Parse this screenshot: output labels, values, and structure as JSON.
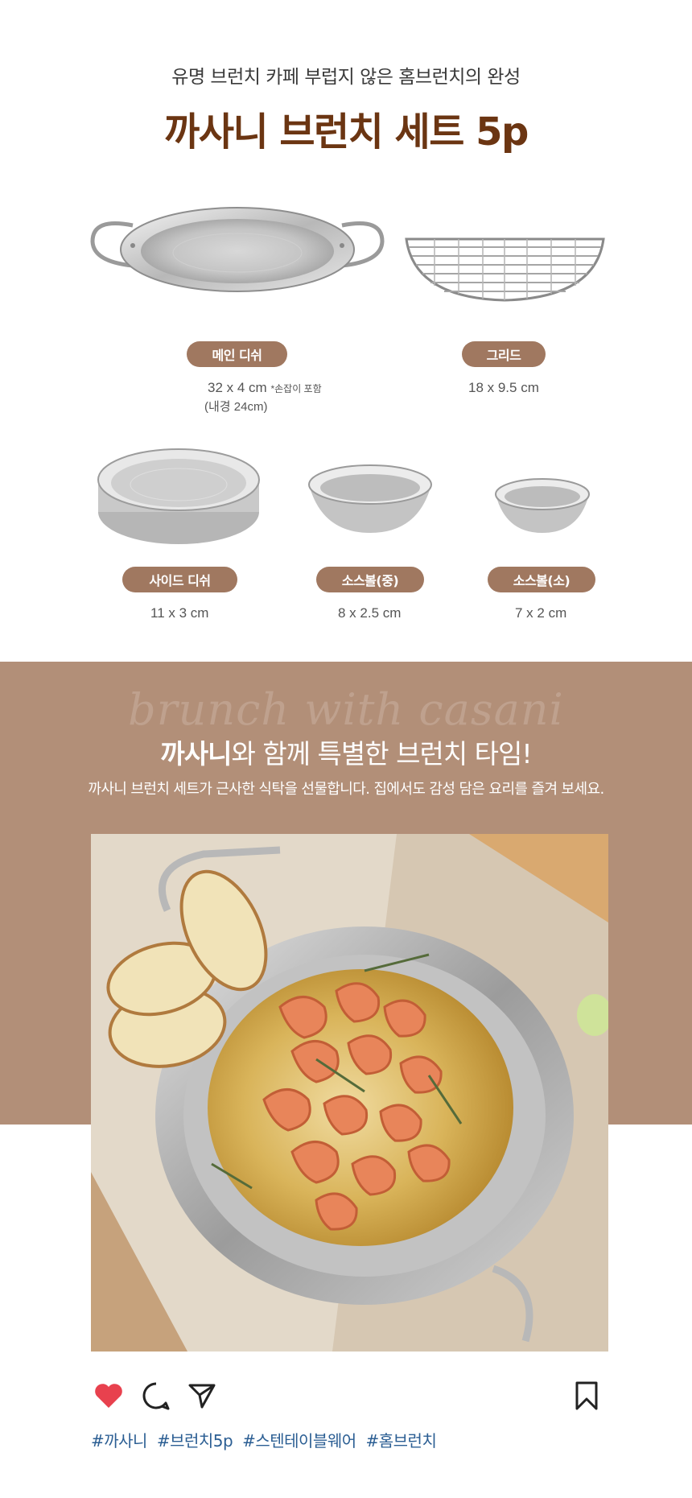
{
  "header": {
    "subtitle": "유명 브런치 카페 부럽지 않은 홈브런치의 완성",
    "title": "까사니 브런치 세트 5p"
  },
  "items": [
    {
      "name": "메인 디쉬",
      "size": "32 x 4 cm",
      "note": "*손잡이 포함",
      "extra": "(내경 24cm)"
    },
    {
      "name": "그리드",
      "size": "18 x 9.5 cm"
    },
    {
      "name": "사이드 디쉬",
      "size": "11 x 3 cm"
    },
    {
      "name": "소스볼(중)",
      "size": "8 x 2.5 cm"
    },
    {
      "name": "소스볼(소)",
      "size": "7 x 2 cm"
    }
  ],
  "band": {
    "script": "brunch with casani",
    "title_bold": "까사니",
    "title_rest": "와 함께 특별한 브런치 타임!",
    "description": "까사니 브런치 세트가 근사한 식탁을 선물합니다. 집에서도 감성 담은 요리를 즐겨 보세요."
  },
  "hashtags": [
    "#까사니",
    "#브런치5p",
    "#스텐테이블웨어",
    "#홈브런치"
  ],
  "colors": {
    "title": "#6b3512",
    "pill": "#a07860",
    "band": "#b28f78",
    "hashtag": "#2b5e93",
    "heart": "#e8414e"
  },
  "icons": [
    "heart-icon",
    "comment-icon",
    "send-icon",
    "bookmark-icon"
  ]
}
